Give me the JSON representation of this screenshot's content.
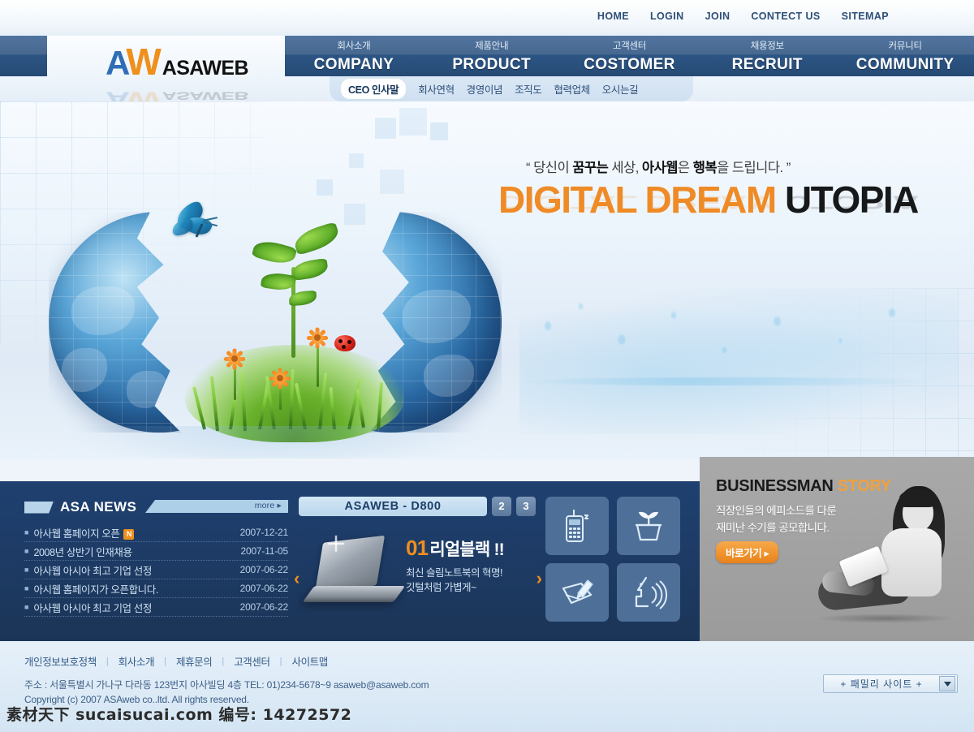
{
  "topnav": {
    "items": [
      {
        "label": "HOME",
        "name": "top-nav-home"
      },
      {
        "label": "LOGIN",
        "name": "top-nav-login"
      },
      {
        "label": "JOIN",
        "name": "top-nav-join"
      },
      {
        "label": "CONTECT US",
        "name": "top-nav-contact"
      },
      {
        "label": "SITEMAP",
        "name": "top-nav-sitemap"
      }
    ]
  },
  "logo": {
    "a": "A",
    "w": "W",
    "name": "ASAWEB"
  },
  "mainnav": {
    "items": [
      {
        "kr": "회사소개",
        "en": "COMPANY"
      },
      {
        "kr": "제품안내",
        "en": "PRODUCT"
      },
      {
        "kr": "고객센터",
        "en": "COSTOMER"
      },
      {
        "kr": "채용정보",
        "en": "RECRUIT"
      },
      {
        "kr": "커뮤니티",
        "en": "COMMUNITY"
      }
    ]
  },
  "subnav": {
    "items": [
      {
        "label": "CEO 인사말",
        "active": true
      },
      {
        "label": "회사연혁",
        "active": false
      },
      {
        "label": "경영이념",
        "active": false
      },
      {
        "label": "조직도",
        "active": false
      },
      {
        "label": "협력업체",
        "active": false
      },
      {
        "label": "오시는길",
        "active": false
      }
    ]
  },
  "hero": {
    "quote_pre": "“ 당신이 ",
    "quote_bold1": "꿈꾸는",
    "quote_mid": " 세상, ",
    "quote_bold2": "아사웹",
    "quote_mid2": "은 ",
    "quote_bold3": "행복",
    "quote_post": "을 드립니다. ”",
    "title_orange": "DIGITAL DREAM",
    "title_dark": " UTOPIA"
  },
  "news": {
    "title": "ASA NEWS",
    "more": "more ▸",
    "items": [
      {
        "text": "아사웹 홈페이지 오픈",
        "date": "2007-12-21",
        "badge": "N"
      },
      {
        "text": "2008년 상반기 인재채용",
        "date": "2007-11-05",
        "badge": ""
      },
      {
        "text": "아사웹 아시아 최고 기업 선정",
        "date": "2007-06-22",
        "badge": ""
      },
      {
        "text": "아시웹 홈페이지가 오픈합니다.",
        "date": "2007-06-22",
        "badge": ""
      },
      {
        "text": "아사웹 아시아 최고 기업 선정",
        "date": "2007-06-22",
        "badge": ""
      }
    ]
  },
  "product": {
    "title": "ASAWEB - D800",
    "tabs": [
      "2",
      "3"
    ],
    "number": "01",
    "headline": "리얼블랙 !!",
    "line1": "최신 슬림노트북의 혁명!",
    "line2": "깃털처럼 가볍게~",
    "prev": "‹",
    "next": "›"
  },
  "quickicons": {
    "items": [
      {
        "name": "mobile-phone-icon"
      },
      {
        "name": "plant-pot-icon"
      },
      {
        "name": "pencil-notepad-icon"
      },
      {
        "name": "speaking-face-icon"
      }
    ]
  },
  "story": {
    "title_1": "BUSINESSMAN",
    "title_2": " STORY",
    "line1": "직장인들의 에피소드를 다룬",
    "line2": "재미난 수기를 공모합니다.",
    "button": "바로가기 ▸"
  },
  "footer": {
    "links": [
      "개인정보보호정책",
      "회사소개",
      "제휴문의",
      "고객센터",
      "사이트맵"
    ],
    "address": "주소 : 서울특별시 가나구 다라동 123번지 아사빌딩 4층 TEL: 01)234-5678~9 asaweb@asaweb.com",
    "copyright": "Copyright (c) 2007 ASAweb  co..ltd. All rights reserved.",
    "family_site": "+ 패밀리 사이트 +"
  },
  "watermark": "素材天下 sucaisucai.com  编号: 14272572",
  "colors": {
    "accent_orange": "#ef8f1c",
    "nav_blue": "#254a74",
    "panel_navy": "#1d3a63",
    "logo_blue": "#2f6db5",
    "story_gray": "#a2a2a2"
  }
}
